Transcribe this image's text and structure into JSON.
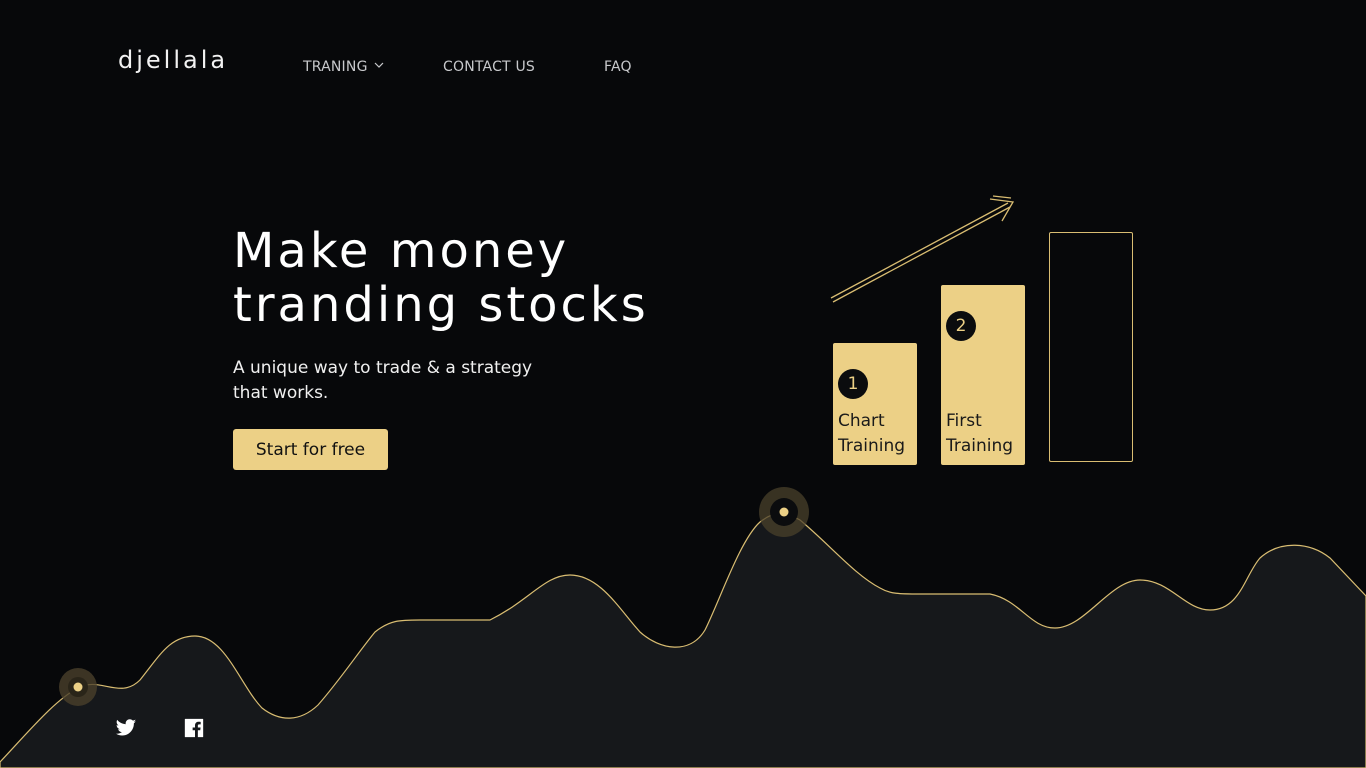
{
  "brand": {
    "logo": "djellala"
  },
  "nav": {
    "training": "TRANING",
    "contact": "CONTACT US",
    "faq": "FAQ"
  },
  "hero": {
    "title_line1": "Make money",
    "title_line2": "tranding stocks",
    "subtitle": "A unique way to trade & a strategy that works.",
    "cta": "Start for free"
  },
  "steps": [
    {
      "number": "1",
      "label_line1": "Chart",
      "label_line2": "Training"
    },
    {
      "number": "2",
      "label_line1": "First",
      "label_line2": "Training"
    }
  ],
  "social": {
    "twitter": "twitter-icon",
    "facebook": "facebook-icon"
  },
  "colors": {
    "accent": "#ecd086",
    "background": "#07080a",
    "wave_fill": "#16181b"
  }
}
